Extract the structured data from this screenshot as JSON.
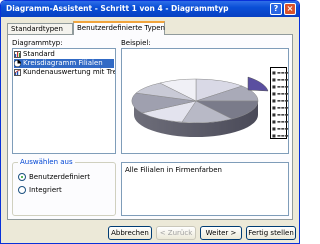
{
  "window": {
    "title": "Diagramm-Assistent - Schritt 1 von 4 - Diagrammtyp",
    "help_glyph": "?",
    "close_glyph": "×"
  },
  "tabs": [
    {
      "label": "Standardtypen"
    },
    {
      "label": "Benutzerdefinierte Typen"
    }
  ],
  "chart_type_label": "Diagrammtyp:",
  "chart_types": [
    {
      "label": "Standard",
      "icon": "standard-chart-icon"
    },
    {
      "label": "Kreisdiagramm Filialen",
      "icon": "pie-chart-icon",
      "selected": true
    },
    {
      "label": "Kundenauswertung mit Trend",
      "icon": "combo-chart-icon"
    }
  ],
  "preview_label": "Beispiel:",
  "preview_legend_placeholders": [
    "■ ▬▬▬",
    "■ ▬▬▬",
    "■ ▬▬▬",
    "■ ▬▬▬",
    "■ ▬▬▬",
    "■ ▬▬▬",
    "■ ▬▬▬",
    "■ ▬▬▬",
    "■ ▬▬▬",
    "■ ▬▬▬"
  ],
  "select_from": {
    "label": "Auswählen aus",
    "options": [
      {
        "label": "Benutzerdefiniert",
        "checked": true
      },
      {
        "label": "Integriert",
        "checked": false
      }
    ]
  },
  "description": "Alle Filialen in Firmenfarben",
  "buttons": {
    "cancel": "Abbrechen",
    "back": "< Zurück",
    "next": "Weiter >",
    "finish": "Fertig stellen"
  },
  "colors": {
    "title_bar": "#0a4fd6",
    "selection": "#316ac5",
    "face": "#ece9d8",
    "group_label": "#0046d5"
  }
}
